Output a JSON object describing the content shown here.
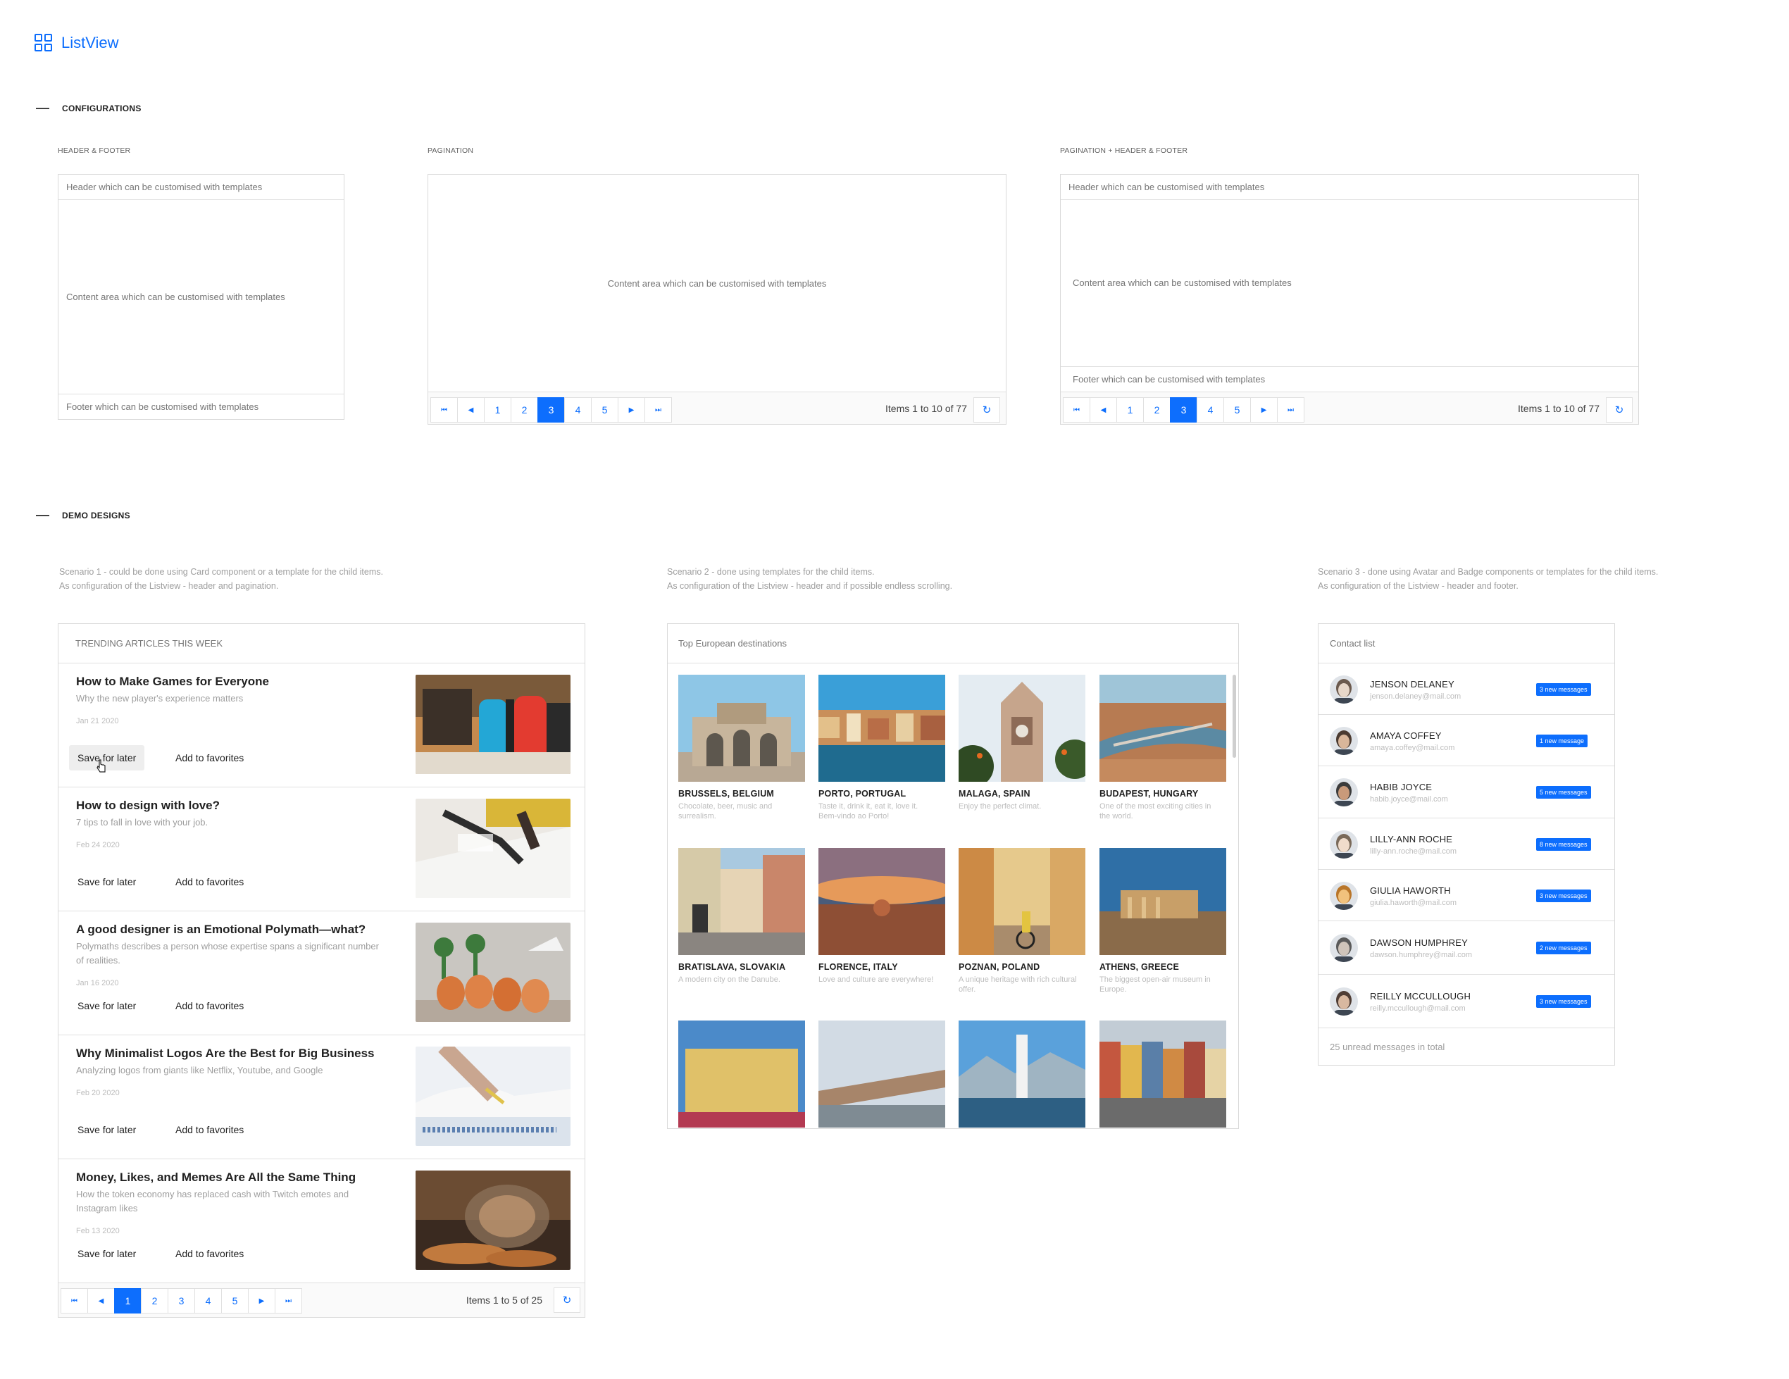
{
  "app": {
    "title": "ListView",
    "icon": "grid-icon"
  },
  "configurations": {
    "heading": "CONFIGURATIONS",
    "hf": {
      "label": "HEADER & FOOTER",
      "header": "Header which can be customised with templates",
      "content": "Content area which can be customised with templates",
      "footer": "Footer which can be customised with templates"
    },
    "pg": {
      "label": "PAGINATION",
      "content": "Content area which can be customised with templates",
      "pages": [
        "1",
        "2",
        "3",
        "4",
        "5"
      ],
      "active_page": "3",
      "info": "Items 1 to 10 of 77"
    },
    "phf": {
      "label": "PAGINATION + HEADER & FOOTER",
      "header": "Header which can be customised with templates",
      "content": "Content area which can be customised with templates",
      "footer": "Footer which can be customised with templates",
      "pages": [
        "1",
        "2",
        "3",
        "4",
        "5"
      ],
      "active_page": "3",
      "info": "Items 1 to 10 of 77"
    }
  },
  "demo": {
    "heading": "DEMO DESIGNS",
    "scenario1": {
      "line1": "Scenario 1 - could be done using Card component or a template for the child items.",
      "line2": "As configuration of the Listview - header and pagination."
    },
    "scenario2": {
      "line1": "Scenario 2 - done using templates for the child items.",
      "line2": "As configuration of the Listview - header and if possible endless scrolling."
    },
    "scenario3": {
      "line1": "Scenario 3 - done using Avatar and Badge components or templates for the child items.",
      "line2": "As configuration of the Listview - header and footer."
    }
  },
  "articles": {
    "header": "TRENDING ARTICLES THIS WEEK",
    "save_label": "Save for later",
    "fav_label": "Add to favorites",
    "items": [
      {
        "title": "How to Make Games for Everyone",
        "subtitle": "Why the new player's experience matters",
        "date": "Jan 21 2020"
      },
      {
        "title": "How to design with love?",
        "subtitle": "7 tips to fall in love with your job.",
        "date": "Feb 24 2020"
      },
      {
        "title": "A good designer is an Emotional Polymath—what?",
        "subtitle": "Polymaths describes a person whose expertise spans a significant number of realities.",
        "date": "Jan 16 2020"
      },
      {
        "title": "Why Minimalist Logos Are the Best for Big Business",
        "subtitle": "Analyzing logos from giants like Netflix, Youtube, and Google",
        "date": "Feb 20 2020"
      },
      {
        "title": "Money, Likes, and Memes Are All the Same Thing",
        "subtitle": "How the token economy has replaced cash with Twitch emotes and Instagram likes",
        "date": "Feb 13 2020"
      }
    ],
    "pages": [
      "1",
      "2",
      "3",
      "4",
      "5"
    ],
    "active_page": "1",
    "info": "Items 1 to 5 of 25"
  },
  "destinations": {
    "header": "Top European destinations",
    "items": [
      {
        "name": "BRUSSELS, BELGIUM",
        "desc": "Chocolate, beer, music and surrealism."
      },
      {
        "name": "PORTO, PORTUGAL",
        "desc": "Taste it, drink it, eat it, love it. Bem-vindo ao Porto!"
      },
      {
        "name": "MALAGA, SPAIN",
        "desc": "Enjoy the perfect climat."
      },
      {
        "name": "BUDAPEST, HUNGARY",
        "desc": "One of the most exciting cities in the world."
      },
      {
        "name": "BRATISLAVA, SLOVAKIA",
        "desc": "A modern city on the Danube."
      },
      {
        "name": "FLORENCE, ITALY",
        "desc": "Love and culture are everywhere!"
      },
      {
        "name": "POZNAN, POLAND",
        "desc": "A unique heritage with rich cultural offer."
      },
      {
        "name": "ATHENS, GREECE",
        "desc": "The biggest open-air museum in Europe."
      }
    ]
  },
  "contacts": {
    "header": "Contact list",
    "footer": "25 unread messages in total",
    "items": [
      {
        "name": "JENSON DELANEY",
        "email": "jenson.delaney@mail.com",
        "badge": "3 new messages"
      },
      {
        "name": "AMAYA COFFEY",
        "email": "amaya.coffey@mail.com",
        "badge": "1 new message"
      },
      {
        "name": "HABIB JOYCE",
        "email": "habib.joyce@mail.com",
        "badge": "5 new messages"
      },
      {
        "name": "LILLY-ANN ROCHE",
        "email": "lilly-ann.roche@mail.com",
        "badge": "8 new messages"
      },
      {
        "name": "GIULIA HAWORTH",
        "email": "giulia.haworth@mail.com",
        "badge": "3 new messages"
      },
      {
        "name": "DAWSON HUMPHREY",
        "email": "dawson.humphrey@mail.com",
        "badge": "2 new messages"
      },
      {
        "name": "REILLY MCCULLOUGH",
        "email": "reilly.mccullough@mail.com",
        "badge": "3 new messages"
      }
    ]
  },
  "colors": {
    "accent": "#0d6efd",
    "border": "#d9d9d9",
    "muted": "#9e9e9e"
  }
}
